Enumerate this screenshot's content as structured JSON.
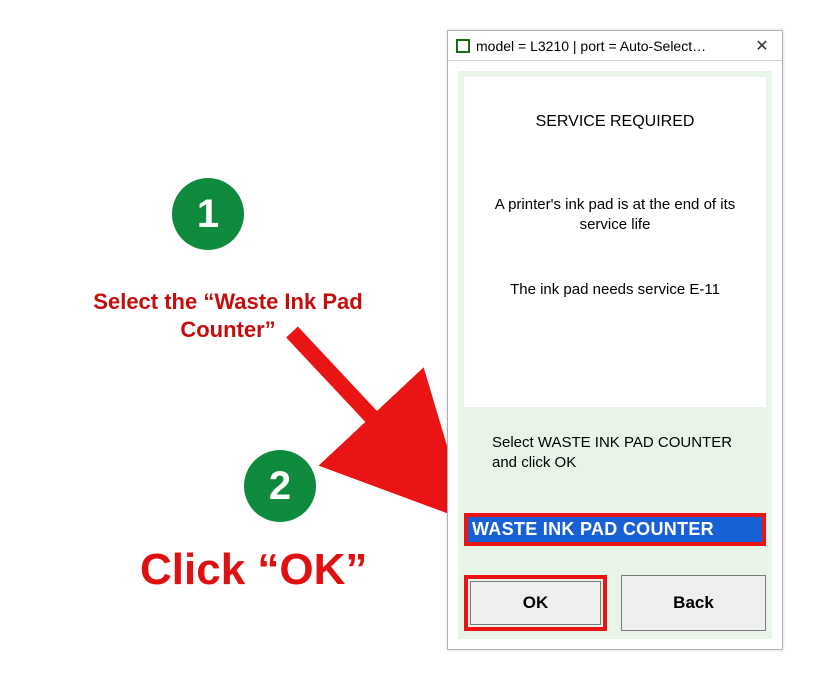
{
  "annotations": {
    "badge1": "1",
    "badge2": "2",
    "instr1": "Select the “Waste Ink Pad Counter”",
    "instr2": "Click “OK”"
  },
  "window": {
    "title": "model = L3210 | port = Auto-Select…",
    "messages": {
      "heading": "SERVICE REQUIRED",
      "line1": "A printer's ink pad is at the end of its service life",
      "line2": "The ink pad needs service E-11"
    },
    "instruction": "Select WASTE INK PAD COUNTER and click OK",
    "list_item": "WASTE INK PAD COUNTER",
    "buttons": {
      "ok": "OK",
      "back": "Back"
    }
  },
  "colors": {
    "green_badge": "#0e8a3c",
    "red_accent": "#ea1414",
    "red_text": "#c40d0d",
    "selection_bg": "#1860d6",
    "panel_bg": "#e9f4e9"
  }
}
